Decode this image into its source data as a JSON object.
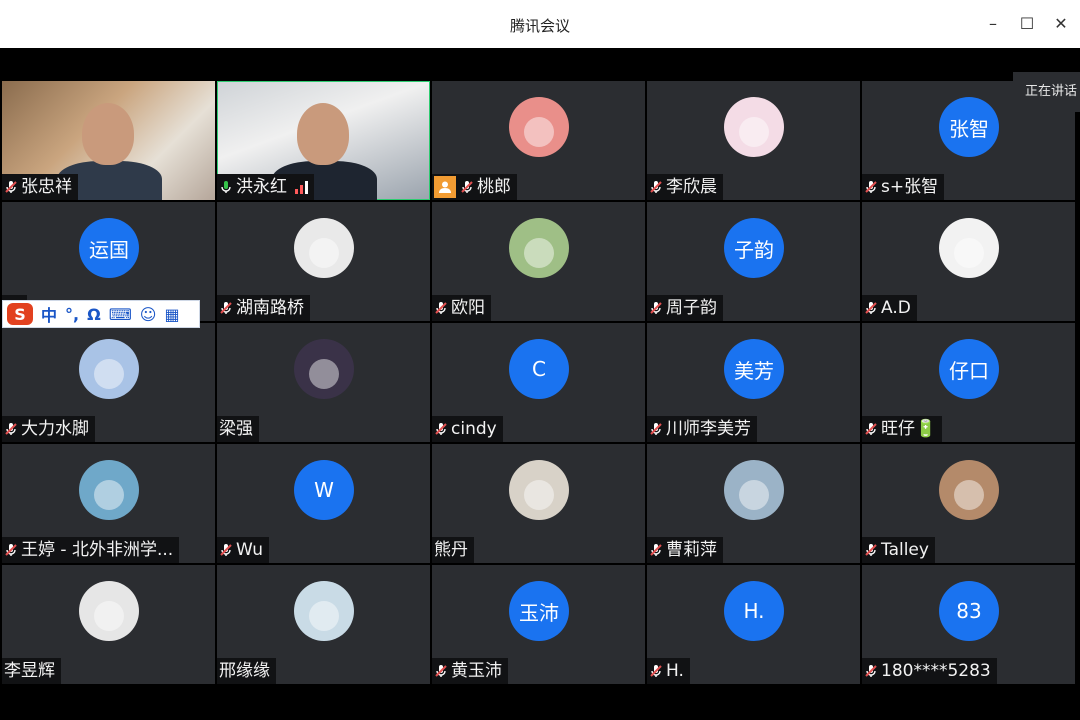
{
  "app": {
    "title": "腾讯会议"
  },
  "window_controls": {
    "minimize": "–",
    "maximize": "☐",
    "close": "✕"
  },
  "speaking_badge": "正在讲话",
  "ime": {
    "logo": "S",
    "lang": "中",
    "punct": "°,",
    "omega": "Ω",
    "keyboard": "⌨",
    "user": "☺",
    "apps": "▦"
  },
  "participants": [
    {
      "name": "张忠祥",
      "type": "video",
      "muted": true
    },
    {
      "name": "洪永红",
      "type": "video",
      "muted": false,
      "active": true
    },
    {
      "name": "桃郎",
      "type": "img",
      "muted": true,
      "badge": true,
      "avatar_color": "#e98f8a"
    },
    {
      "name": "李欣晨",
      "type": "img",
      "muted": true,
      "avatar_color": "#f4dce6"
    },
    {
      "name": "s+张智",
      "type": "text",
      "avatar_text": "张智",
      "muted": true
    },
    {
      "name": "",
      "type": "text",
      "avatar_text": "运国",
      "muted": true
    },
    {
      "name": "湖南路桥",
      "type": "img",
      "muted": true,
      "avatar_color": "#e9e9e9"
    },
    {
      "name": "欧阳",
      "type": "img",
      "muted": true,
      "avatar_color": "#9fbf86"
    },
    {
      "name": "周子韵",
      "type": "text",
      "avatar_text": "子韵",
      "muted": true
    },
    {
      "name": "A.D",
      "type": "img",
      "muted": true,
      "avatar_color": "#f2f2f2"
    },
    {
      "name": "大力水脚",
      "type": "img",
      "muted": true,
      "avatar_color": "#a9c3e6"
    },
    {
      "name": "梁强",
      "type": "img",
      "muted": false,
      "nomic": true,
      "avatar_color": "#3a3248"
    },
    {
      "name": "cindy",
      "type": "text",
      "avatar_text": "C",
      "muted": true
    },
    {
      "name": "川师李美芳",
      "type": "text",
      "avatar_text": "美芳",
      "muted": true
    },
    {
      "name": "旺仔🔋",
      "type": "text",
      "avatar_text": "仔口",
      "muted": true
    },
    {
      "name": "王婷 - 北外非洲学...",
      "type": "img",
      "muted": true,
      "avatar_color": "#6fa8c9"
    },
    {
      "name": "Wu",
      "type": "text",
      "avatar_text": "W",
      "muted": true
    },
    {
      "name": "熊丹",
      "type": "img",
      "muted": false,
      "nomic": true,
      "avatar_color": "#d8d2c8"
    },
    {
      "name": "曹莉萍",
      "type": "img",
      "muted": true,
      "avatar_color": "#9bb3c7"
    },
    {
      "name": "Talley",
      "type": "img",
      "muted": true,
      "avatar_color": "#b48a6a"
    },
    {
      "name": "李昱辉",
      "type": "img",
      "muted": false,
      "nomic": true,
      "avatar_color": "#e6e6e6"
    },
    {
      "name": "邢缘缘",
      "type": "img",
      "muted": false,
      "nomic": true,
      "avatar_color": "#c9dbe6"
    },
    {
      "name": "黄玉沛",
      "type": "text",
      "avatar_text": "玉沛",
      "muted": true
    },
    {
      "name": "H.",
      "type": "text",
      "avatar_text": "H.",
      "muted": true
    },
    {
      "name": "180****5283",
      "type": "text",
      "avatar_text": "83",
      "muted": true
    }
  ],
  "colors": {
    "accent": "#1a73f0",
    "tile": "#2b2d31",
    "muted_red": "#e05050",
    "mic_green": "#36c24a"
  }
}
